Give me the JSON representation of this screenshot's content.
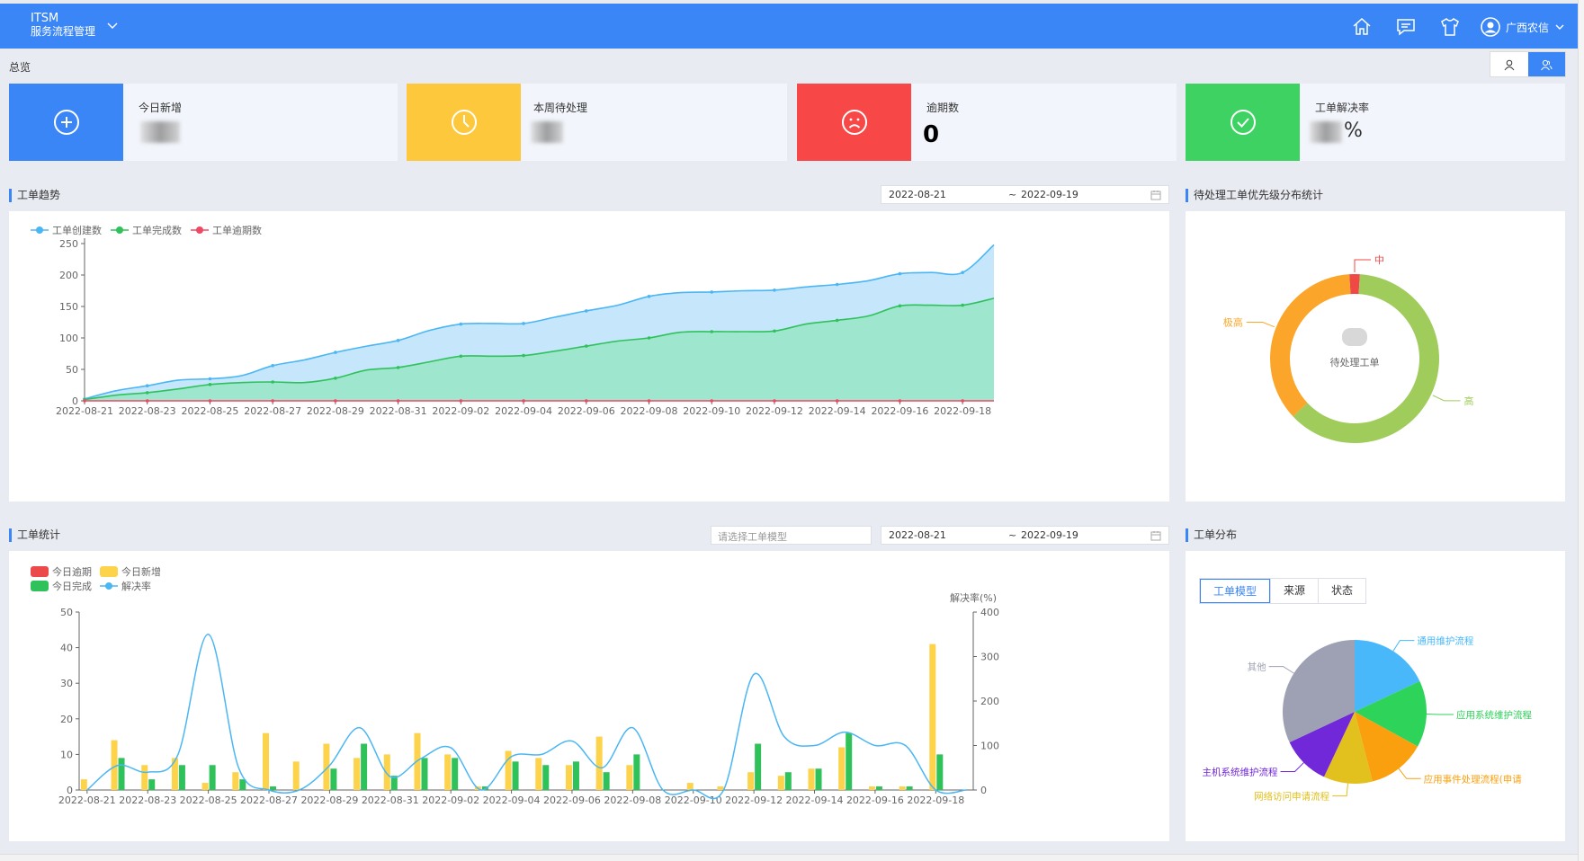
{
  "app": {
    "name": "ITSM",
    "subtitle": "服务流程管理",
    "user": "广西农信"
  },
  "overview_label": "总览",
  "stats": [
    {
      "label": "今日新增",
      "value": "",
      "color": "#3b86f6",
      "icon": "plus-circle-icon"
    },
    {
      "label": "本周待处理",
      "value": "",
      "color": "#fdc83b",
      "icon": "clock-icon"
    },
    {
      "label": "逾期数",
      "value": "0",
      "color": "#f74747",
      "icon": "sad-face-icon"
    },
    {
      "label": "工单解决率",
      "value": "%",
      "color": "#3dd262",
      "icon": "check-circle-icon"
    }
  ],
  "trend": {
    "title": "工单趋势",
    "date_start": "2022-08-21",
    "date_sep": "~",
    "date_end": "2022-09-19",
    "legend": [
      "工单创建数",
      "工单完成数",
      "工单逾期数"
    ]
  },
  "priority": {
    "title": "待处理工单优先级分布统计",
    "center_label": "待处理工单",
    "labels": [
      "中",
      "极高",
      "高"
    ]
  },
  "stats_chart": {
    "title": "工单统计",
    "model_placeholder": "请选择工单模型",
    "date_start": "2022-08-21",
    "date_sep": "~",
    "date_end": "2022-09-19",
    "legend": [
      "今日逾期",
      "今日新增",
      "今日完成",
      "解决率"
    ],
    "right_axis_label": "解决率(%)"
  },
  "distribution": {
    "title": "工单分布",
    "tabs": [
      "工单模型",
      "来源",
      "状态"
    ],
    "labels": [
      "通用维护流程",
      "应用系统维护流程",
      "应用事件处理流程(申请",
      "网络访问申请流程",
      "主机系统维护流程",
      "其他"
    ]
  },
  "chart_data": [
    {
      "type": "area",
      "title": "",
      "x": [
        "2022-08-21",
        "2022-08-22",
        "2022-08-23",
        "2022-08-24",
        "2022-08-25",
        "2022-08-26",
        "2022-08-27",
        "2022-08-28",
        "2022-08-29",
        "2022-08-30",
        "2022-08-31",
        "2022-09-01",
        "2022-09-02",
        "2022-09-03",
        "2022-09-04",
        "2022-09-05",
        "2022-09-06",
        "2022-09-07",
        "2022-09-08",
        "2022-09-09",
        "2022-09-10",
        "2022-09-11",
        "2022-09-12",
        "2022-09-13",
        "2022-09-14",
        "2022-09-15",
        "2022-09-16",
        "2022-09-17",
        "2022-09-18",
        "2022-09-19"
      ],
      "x_ticks": [
        "2022-08-21",
        "2022-08-23",
        "2022-08-25",
        "2022-08-27",
        "2022-08-29",
        "2022-08-31",
        "2022-09-02",
        "2022-09-04",
        "2022-09-06",
        "2022-09-08",
        "2022-09-10",
        "2022-09-12",
        "2022-09-14",
        "2022-09-16",
        "2022-09-18"
      ],
      "ylim": [
        0,
        250
      ],
      "y_ticks": [
        0,
        50,
        100,
        150,
        200,
        250
      ],
      "series": [
        {
          "name": "工单创建数",
          "color": "#4ab6f4",
          "values": [
            3,
            16,
            24,
            33,
            35,
            40,
            56,
            65,
            77,
            87,
            96,
            112,
            122,
            123,
            123,
            133,
            143,
            152,
            166,
            172,
            173,
            175,
            176,
            181,
            185,
            191,
            202,
            204,
            204,
            248
          ]
        },
        {
          "name": "工单完成数",
          "color": "#2fc25b",
          "values": [
            2,
            9,
            13,
            19,
            26,
            29,
            30,
            29,
            36,
            49,
            53,
            62,
            71,
            71,
            72,
            79,
            87,
            95,
            100,
            109,
            110,
            110,
            111,
            122,
            128,
            135,
            151,
            152,
            152,
            163
          ]
        },
        {
          "name": "工单逾期数",
          "color": "#f04864",
          "values": [
            0,
            0,
            0,
            0,
            0,
            0,
            0,
            0,
            0,
            0,
            0,
            0,
            0,
            0,
            0,
            0,
            0,
            0,
            0,
            0,
            0,
            0,
            0,
            0,
            0,
            0,
            0,
            0,
            0,
            0
          ]
        }
      ]
    },
    {
      "type": "pie",
      "title": "",
      "series": [
        {
          "name": "中",
          "value": 2,
          "color": "#f04845"
        },
        {
          "name": "高",
          "value": 62,
          "color": "#a0cc5c"
        },
        {
          "name": "极高",
          "value": 36,
          "color": "#fba62a"
        }
      ]
    },
    {
      "type": "bar",
      "title": "",
      "categories": [
        "2022-08-21",
        "2022-08-22",
        "2022-08-23",
        "2022-08-24",
        "2022-08-25",
        "2022-08-26",
        "2022-08-27",
        "2022-08-28",
        "2022-08-29",
        "2022-08-30",
        "2022-08-31",
        "2022-09-01",
        "2022-09-02",
        "2022-09-03",
        "2022-09-04",
        "2022-09-05",
        "2022-09-06",
        "2022-09-07",
        "2022-09-08",
        "2022-09-09",
        "2022-09-10",
        "2022-09-11",
        "2022-09-12",
        "2022-09-13",
        "2022-09-14",
        "2022-09-15",
        "2022-09-16",
        "2022-09-17",
        "2022-09-18",
        "2022-09-19"
      ],
      "x_ticks": [
        "2022-08-21",
        "2022-08-23",
        "2022-08-25",
        "2022-08-27",
        "2022-08-29",
        "2022-08-31",
        "2022-09-02",
        "2022-09-04",
        "2022-09-06",
        "2022-09-08",
        "2022-09-10",
        "2022-09-12",
        "2022-09-14",
        "2022-09-16",
        "2022-09-18"
      ],
      "ylim": [
        0,
        50
      ],
      "y_ticks": [
        0,
        10,
        20,
        30,
        40,
        50
      ],
      "y2lim": [
        0,
        400
      ],
      "y2_ticks": [
        0,
        100,
        200,
        300,
        400
      ],
      "ylabel_right": "解决率(%)",
      "series": [
        {
          "name": "今日逾期",
          "color": "#ec4a4a",
          "values": [
            0,
            0,
            0,
            0,
            0,
            0,
            0,
            0,
            0,
            0,
            0,
            0,
            0,
            0,
            0,
            0,
            0,
            0,
            0,
            0,
            0,
            0,
            0,
            0,
            0,
            0,
            0,
            0,
            0,
            0
          ]
        },
        {
          "name": "今日新增",
          "color": "#fcd34a",
          "values": [
            3,
            14,
            7,
            9,
            2,
            5,
            16,
            8,
            13,
            9,
            10,
            16,
            10,
            1,
            11,
            9,
            7,
            15,
            7,
            0,
            2,
            1,
            5,
            4,
            6,
            12,
            1,
            1,
            41,
            0
          ]
        },
        {
          "name": "今日完成",
          "color": "#2fc25b",
          "values": [
            0,
            9,
            3,
            7,
            7,
            3,
            1,
            0,
            6,
            13,
            4,
            9,
            9,
            1,
            8,
            7,
            8,
            5,
            10,
            0,
            0,
            0,
            13,
            5,
            6,
            16,
            1,
            1,
            10,
            0
          ]
        },
        {
          "name": "解决率",
          "color": "#4ab6f4",
          "axis": "right",
          "values": [
            0,
            55,
            40,
            80,
            350,
            50,
            0,
            0,
            55,
            140,
            30,
            70,
            95,
            0,
            75,
            80,
            110,
            50,
            140,
            0,
            0,
            0,
            260,
            120,
            100,
            130,
            100,
            100,
            0,
            0
          ]
        }
      ]
    },
    {
      "type": "pie",
      "title": "",
      "series": [
        {
          "name": "通用维护流程",
          "value": 18,
          "color": "#48b8fa"
        },
        {
          "name": "应用系统维护流程",
          "value": 15,
          "color": "#2ed35a"
        },
        {
          "name": "应用事件处理流程(申请",
          "value": 13,
          "color": "#fa9f0d"
        },
        {
          "name": "网络访问申请流程",
          "value": 11,
          "color": "#e2c01d"
        },
        {
          "name": "主机系统维护流程",
          "value": 11,
          "color": "#7028d9"
        },
        {
          "name": "其他",
          "value": 32,
          "color": "#9ea1b4"
        }
      ]
    }
  ]
}
